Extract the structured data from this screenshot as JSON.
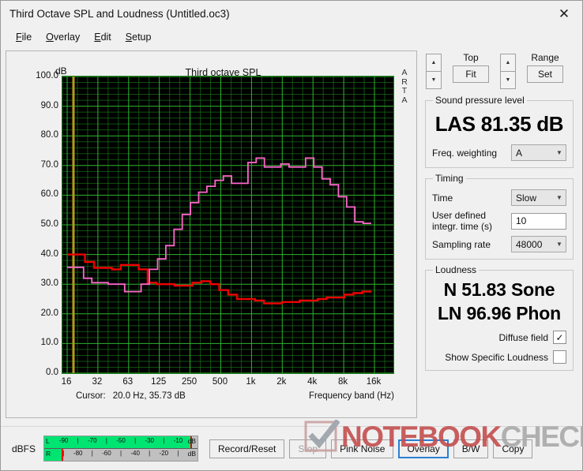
{
  "window": {
    "title": "Third Octave SPL and Loudness (Untitled.oc3)",
    "close_icon": "✕"
  },
  "menu": {
    "items": [
      {
        "mnemonic": "F",
        "rest": "ile"
      },
      {
        "mnemonic": "O",
        "rest": "verlay"
      },
      {
        "mnemonic": "E",
        "rest": "dit"
      },
      {
        "mnemonic": "S",
        "rest": "etup"
      }
    ]
  },
  "graph": {
    "title": "Third octave SPL",
    "y_unit": "dB",
    "brand": "ARTA",
    "cursor_label": "Cursor:",
    "cursor_value": "20.0 Hz, 35.73 dB",
    "x_axis_title": "Frequency band (Hz)"
  },
  "chart_data": {
    "type": "line",
    "title": "Third octave SPL",
    "xlabel": "Frequency band (Hz)",
    "ylabel": "dB",
    "ylim": [
      0.0,
      100.0
    ],
    "yticks": [
      "0.0",
      "10.0",
      "20.0",
      "30.0",
      "40.0",
      "50.0",
      "60.0",
      "70.0",
      "80.0",
      "90.0",
      "100.0"
    ],
    "xticks": [
      "16",
      "32",
      "63",
      "125",
      "250",
      "500",
      "1k",
      "2k",
      "4k",
      "8k",
      "16k"
    ],
    "grid": true,
    "legend": "none",
    "x_scale": "log third-octave bands",
    "bands_hz": [
      16,
      20,
      25,
      31.5,
      40,
      50,
      63,
      80,
      100,
      125,
      160,
      200,
      250,
      315,
      400,
      500,
      630,
      800,
      1000,
      1250,
      1600,
      2000,
      2500,
      3150,
      4000,
      5000,
      6300,
      8000,
      10000,
      12500,
      16000,
      20000
    ],
    "series": [
      {
        "name": "SPL (pink)",
        "color": "#ff66cc",
        "values": [
          35.7,
          35.7,
          32.0,
          30.5,
          30.5,
          30.0,
          30.0,
          27.5,
          27.5,
          30.0,
          35.0,
          38.5,
          43.0,
          48.5,
          53.5,
          57.5,
          61.0,
          63.0,
          65.0,
          66.5,
          64.0,
          64.0,
          71.0,
          72.5,
          69.5,
          69.5,
          70.5,
          69.5,
          69.5,
          72.5,
          69.5,
          65.5,
          63.5,
          59.5,
          56.0,
          51.0,
          50.5
        ]
      },
      {
        "name": "Noise floor (red)",
        "color": "#ee0000",
        "values": [
          40.0,
          40.0,
          37.5,
          35.5,
          35.5,
          35.0,
          36.5,
          36.5,
          35.0,
          30.5,
          30.0,
          30.0,
          29.5,
          29.5,
          30.5,
          31.0,
          30.0,
          28.0,
          26.5,
          25.0,
          25.0,
          24.5,
          23.5,
          23.5,
          24.0,
          24.0,
          24.5,
          24.5,
          25.0,
          25.5,
          25.5,
          26.5,
          27.0,
          27.5
        ]
      }
    ]
  },
  "controls": {
    "top": {
      "label": "Top",
      "button": "Fit",
      "up_icon": "▲",
      "down_icon": "▼"
    },
    "range": {
      "label": "Range",
      "button": "Set",
      "up_icon": "▲",
      "down_icon": "▼"
    },
    "spl": {
      "group": "Sound pressure level",
      "readout": "LAS 81.35 dB",
      "weighting_label": "Freq. weighting",
      "weighting_value": "A"
    },
    "timing": {
      "group": "Timing",
      "time_label": "Time",
      "time_value": "Slow",
      "integr_label_line1": "User defined",
      "integr_label_line2": "integr. time (s)",
      "integr_value": "10",
      "sampling_label": "Sampling rate",
      "sampling_value": "48000"
    },
    "loudness": {
      "group": "Loudness",
      "sone": "N 51.83 Sone",
      "phon": "LN 96.96 Phon",
      "diffuse_label": "Diffuse field",
      "diffuse_checked": "✓",
      "specific_label": "Show Specific Loudness",
      "specific_checked": ""
    },
    "dropdown_arrow": "▼"
  },
  "bottom": {
    "dbfs_label": "dBFS",
    "meter": {
      "left_channel": "L",
      "right_channel": "R",
      "unit": "dB",
      "left_ticks": [
        "-90",
        "|",
        "-70",
        "|",
        "-50",
        "|",
        "-30",
        "|",
        "-10"
      ],
      "right_ticks": [
        "|",
        "-80",
        "|",
        "-60",
        "|",
        "-40",
        "|",
        "-20",
        "|"
      ],
      "left_fill_pct": 96,
      "right_fill_pct": 12
    },
    "buttons": [
      {
        "label": "Record/Reset",
        "state": "normal"
      },
      {
        "label": "Stop",
        "state": "disabled"
      },
      {
        "label": "Pink Noise",
        "state": "normal"
      },
      {
        "label": "Overlay",
        "state": "focused"
      },
      {
        "label": "B/W",
        "state": "normal"
      },
      {
        "label": "Copy",
        "state": "normal"
      }
    ]
  },
  "watermark": {
    "note": "NOTE",
    "book": "BOOK",
    "check": "CHECK"
  },
  "colors": {
    "plot_bg": "#000000",
    "grid": "#1f8f1f",
    "grid_major": "#2fbf2f",
    "cursor": "#b89a18",
    "spl_curve": "#ff66cc",
    "noise_curve": "#ee0000",
    "meter_green": "#00e472",
    "meter_peak": "#f00000",
    "focus_blue": "#2a7fd4"
  }
}
